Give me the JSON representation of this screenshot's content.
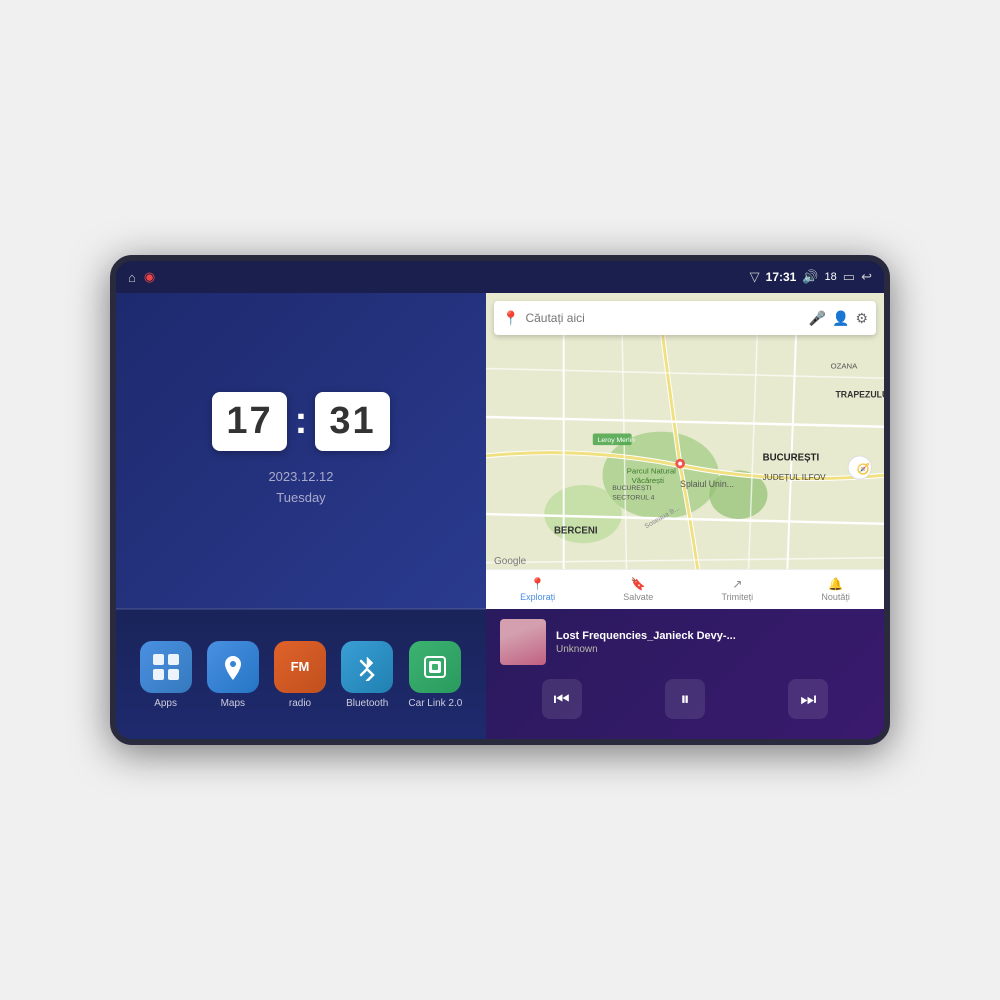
{
  "device": {
    "screen_bg": "#1e2a5e"
  },
  "status_bar": {
    "left_icons": [
      "home",
      "maps-pin"
    ],
    "signal_icon": "▽",
    "time": "17:31",
    "volume_icon": "🔊",
    "battery_level": "18",
    "battery_icon": "🔋",
    "back_icon": "↩"
  },
  "clock": {
    "hour": "17",
    "minute": "31",
    "date": "2023.12.12",
    "day": "Tuesday"
  },
  "apps": [
    {
      "id": "apps",
      "label": "Apps",
      "icon": "⊞",
      "class": "icon-apps"
    },
    {
      "id": "maps",
      "label": "Maps",
      "icon": "📍",
      "class": "icon-maps"
    },
    {
      "id": "radio",
      "label": "radio",
      "icon": "FM",
      "class": "icon-radio"
    },
    {
      "id": "bluetooth",
      "label": "Bluetooth",
      "icon": "⚡",
      "class": "icon-bluetooth"
    },
    {
      "id": "carlink",
      "label": "Car Link 2.0",
      "icon": "📱",
      "class": "icon-carlink"
    }
  ],
  "map": {
    "search_placeholder": "Căutați aici",
    "location_areas": [
      "TRAPEZULUI",
      "BUCUREȘTI",
      "JUDEȚUL ILFOV",
      "BERCENI"
    ],
    "bottom_nav": [
      {
        "label": "Explorați",
        "active": true
      },
      {
        "label": "Salvate",
        "active": false
      },
      {
        "label": "Trimiteți",
        "active": false
      },
      {
        "label": "Noutăți",
        "active": false
      }
    ]
  },
  "music": {
    "title": "Lost Frequencies_Janieck Devy-...",
    "artist": "Unknown",
    "controls": {
      "prev": "⏮",
      "play_pause": "⏸",
      "next": "⏭"
    }
  }
}
